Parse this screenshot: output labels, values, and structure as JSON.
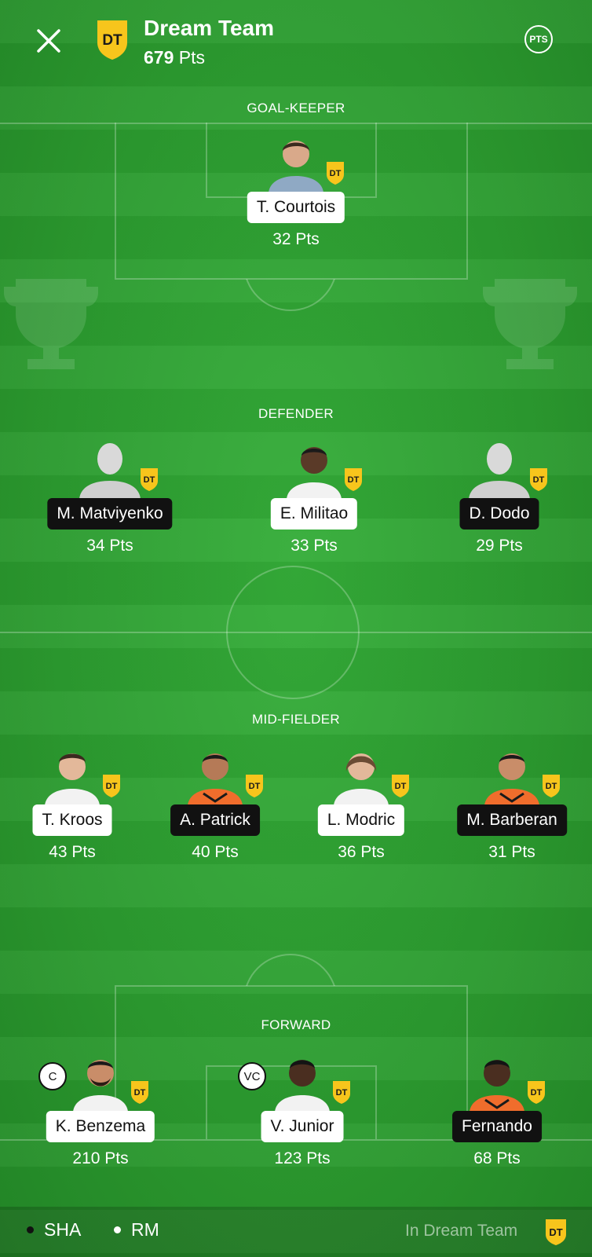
{
  "header": {
    "title": "Dream Team",
    "total_points": "679",
    "points_unit": "Pts",
    "logo_text": "DT",
    "pts_button": "PTS"
  },
  "colors": {
    "badge": "#f7c51c",
    "pitch": "#2a9a2e"
  },
  "sections": {
    "goalkeeper": "GOAL-KEEPER",
    "defender": "DEFENDER",
    "midfielder": "MID-FIELDER",
    "forward": "FORWARD"
  },
  "players": {
    "gk1": {
      "name": "T. Courtois",
      "points": "32 Pts"
    },
    "def1": {
      "name": "M. Matviyenko",
      "points": "34 Pts"
    },
    "def2": {
      "name": "E. Militao",
      "points": "33 Pts"
    },
    "def3": {
      "name": "D. Dodo",
      "points": "29 Pts"
    },
    "mid1": {
      "name": "T. Kroos",
      "points": "43 Pts"
    },
    "mid2": {
      "name": "A. Patrick",
      "points": "40 Pts"
    },
    "mid3": {
      "name": "L. Modric",
      "points": "36 Pts"
    },
    "mid4": {
      "name": "M. Barberan",
      "points": "31 Pts"
    },
    "fwd1": {
      "name": "K. Benzema",
      "points": "210 Pts",
      "role": "C"
    },
    "fwd2": {
      "name": "V. Junior",
      "points": "123 Pts",
      "role": "VC"
    },
    "fwd3": {
      "name": "Fernando",
      "points": "68 Pts"
    }
  },
  "footer": {
    "team1": "SHA",
    "team2": "RM",
    "legend": "In Dream Team"
  }
}
